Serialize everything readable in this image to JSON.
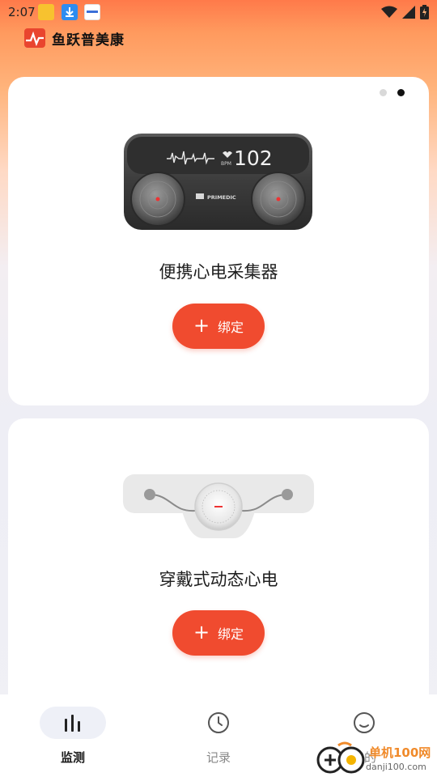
{
  "status_bar": {
    "time": "2:07",
    "notification_icons": [
      "app-icon",
      "download-icon",
      "app-icon"
    ],
    "system_icons": [
      "wifi-icon",
      "signal-icon",
      "battery-charging-icon"
    ]
  },
  "app": {
    "title": "鱼跃普美康",
    "logo_icon": "ecg-logo-icon"
  },
  "pager": {
    "count": 2,
    "active_index": 1
  },
  "devices": [
    {
      "name": "便携心电采集器",
      "screen_value": "102",
      "screen_unit": "BPM",
      "brand": "PRIMEDIC",
      "bind_label": "绑定",
      "bind_icon": "plus-icon"
    },
    {
      "name": "穿戴式动态心电",
      "bind_label": "绑定",
      "bind_icon": "plus-icon"
    }
  ],
  "bottom_nav": {
    "items": [
      {
        "label": "监测",
        "icon": "bar-chart-icon",
        "active": true
      },
      {
        "label": "记录",
        "icon": "clock-icon",
        "active": false
      },
      {
        "label": "我的",
        "icon": "smile-icon",
        "active": false
      }
    ]
  },
  "watermark": {
    "text": "单机100网",
    "url": "danji100.com"
  },
  "colors": {
    "accent": "#f04b2f",
    "header_gradient_top": "#ff7a4a",
    "background": "#f0f0f5",
    "card": "#ffffff"
  }
}
